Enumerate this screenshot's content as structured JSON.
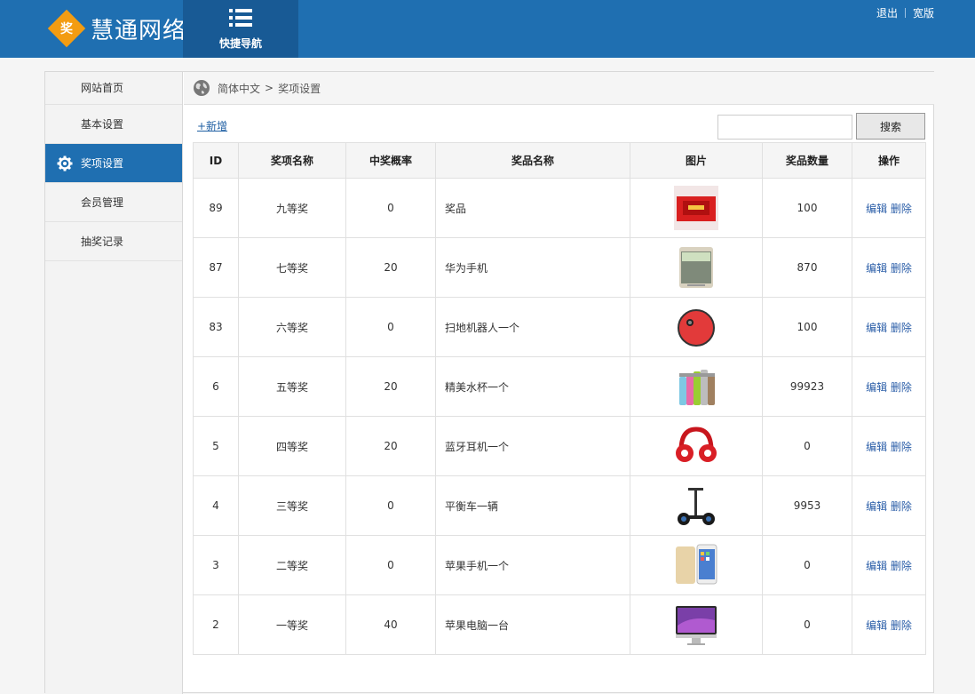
{
  "header": {
    "logo_char": "奖",
    "brand": "慧通网络",
    "quick_nav_label": "快捷导航",
    "logout": "退出",
    "wide": "宽版"
  },
  "sidebar": {
    "items": [
      {
        "label": "网站首页"
      },
      {
        "label": "基本设置"
      },
      {
        "label": "奖项设置",
        "active": true
      },
      {
        "label": "会员管理"
      },
      {
        "label": "抽奖记录"
      }
    ]
  },
  "breadcrumb": {
    "root": "简体中文",
    "separator": ">",
    "current": "奖项设置"
  },
  "toolbar": {
    "add_label": "+新增",
    "search_value": "",
    "search_button": "搜索"
  },
  "table": {
    "columns": [
      "ID",
      "奖项名称",
      "中奖概率",
      "奖品名称",
      "图片",
      "奖品数量",
      "操作"
    ],
    "edit_label": "编辑",
    "delete_label": "删除",
    "rows": [
      {
        "id": "89",
        "level": "九等奖",
        "prob": "0",
        "prize": "奖品",
        "image": "red-envelope-box",
        "qty": "100"
      },
      {
        "id": "87",
        "level": "七等奖",
        "prob": "20",
        "prize": "华为手机",
        "image": "huawei-phone",
        "qty": "870"
      },
      {
        "id": "83",
        "level": "六等奖",
        "prob": "0",
        "prize": "扫地机器人一个",
        "image": "robot-vacuum",
        "qty": "100"
      },
      {
        "id": "6",
        "level": "五等奖",
        "prob": "20",
        "prize": "精美水杯一个",
        "image": "water-bottles",
        "qty": "99923"
      },
      {
        "id": "5",
        "level": "四等奖",
        "prob": "20",
        "prize": "蓝牙耳机一个",
        "image": "red-headphones",
        "qty": "0"
      },
      {
        "id": "4",
        "level": "三等奖",
        "prob": "0",
        "prize": "平衡车一辆",
        "image": "balance-scooter",
        "qty": "9953"
      },
      {
        "id": "3",
        "level": "二等奖",
        "prob": "0",
        "prize": "苹果手机一个",
        "image": "iphone",
        "qty": "0"
      },
      {
        "id": "2",
        "level": "一等奖",
        "prob": "40",
        "prize": "苹果电脑一台",
        "image": "imac",
        "qty": "0"
      }
    ]
  },
  "colors": {
    "topbar": "#1f6fb1",
    "quicknav": "#185a95",
    "active_nav": "#1f6fb1",
    "logo": "#f39c12",
    "link": "#2b5ea8"
  }
}
